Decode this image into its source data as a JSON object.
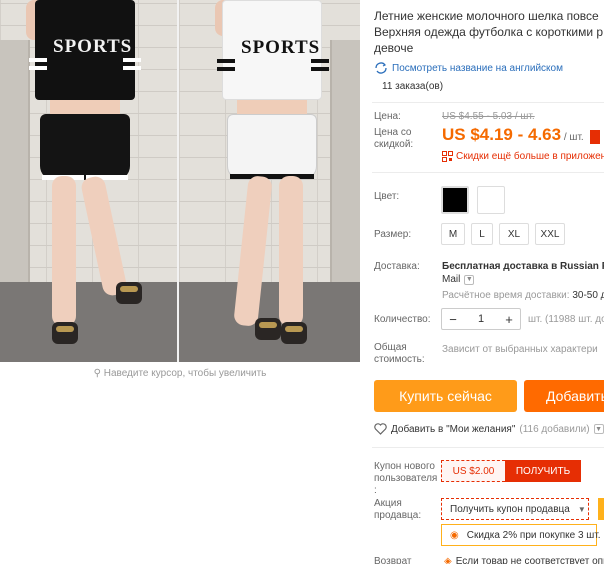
{
  "product": {
    "title_lines": [
      "Летние женские молочного шелка повсе",
      "Верхняя одежда футболка с короткими р",
      "девоче"
    ],
    "translate_link": "Посмотреть название на английском",
    "orders": "11 заказа(ов)"
  },
  "gallery": {
    "tee_text_left": "SPORTS",
    "tee_text_right": "SPORTS",
    "zoom_hint": "Наведите курсор, чтобы увеличить"
  },
  "price": {
    "label": "Цена:",
    "old": "US $4.55 - 5.03 / шт.",
    "discount_label": "Цена со скидкой:",
    "new": "US $4.19 - 4.63",
    "unit": "/ шт.",
    "app_deal": "Скидки ещё больше в приложен"
  },
  "color": {
    "label": "Цвет:",
    "swatches": [
      "#000000",
      "#ffffff"
    ]
  },
  "size": {
    "label": "Размер:",
    "options": [
      "M",
      "L",
      "XL",
      "XXL"
    ]
  },
  "shipping": {
    "label": "Доставка:",
    "value_line1": "Бесплатная доставка в Russian Fe",
    "value_line2": "Mail",
    "eta_label": "Расчётное время доставки:",
    "eta_value": "30-50 д"
  },
  "quantity": {
    "label": "Количество:",
    "value": "1",
    "minus": "−",
    "plus": "+",
    "stock": "шт. (11988 шт. дос"
  },
  "total": {
    "label": "Общая стоимость:",
    "value": "Зависит от выбранных характери"
  },
  "actions": {
    "buy_now": "Купить сейчас",
    "add_to_cart": "Добавить"
  },
  "wishlist": {
    "label": "Добавить в \"Мои желания\"",
    "count": "(116 добавили)"
  },
  "coupon": {
    "label": "Купон нового пользователя :",
    "amount": "US $2.00",
    "get": "ПОЛУЧИТЬ"
  },
  "seller_promo": {
    "label": "Акция продавца:",
    "dropdown1": "Получить купон продавца",
    "dropdown2": "Скидка 2% при покупке 3 шт."
  },
  "return": {
    "label": "Возврат",
    "value": "Если товар не соответствует опи"
  },
  "colors": {
    "accent_orange": "#ff9b19",
    "cart_orange": "#ff6a00",
    "price_orange": "#f56a00",
    "red": "#e62e04",
    "link_blue": "#2a6ebb"
  }
}
